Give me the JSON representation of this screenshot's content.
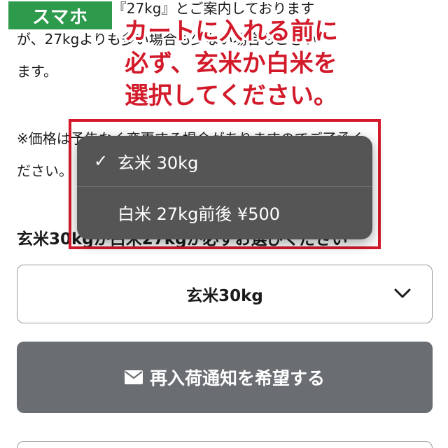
{
  "badge": {
    "label": "スマホ"
  },
  "description": {
    "line1": "※ご案内画像は『27kg』とご案内しております",
    "line2": "が、27kgよりも多い場合も少ない場合もござい",
    "line3": "ます。",
    "line4": "※価格は予告なく変更する場合がありますのでご了承く",
    "line5": "ださい。"
  },
  "callout": {
    "line1": "カートに入れる前に",
    "line2": "必ず、玄米か白米を",
    "line3": "選択してください。"
  },
  "dropdown": {
    "options": [
      {
        "check": "✓",
        "label": "玄米 30kg",
        "selected": true
      },
      {
        "check": "",
        "label": "白米 27kg前後 ¥500",
        "selected": false
      }
    ]
  },
  "select": {
    "label": "玄米30kgか白米27kgか必ずお選びください",
    "value": "玄米30kg",
    "chevron_icon": "chevron-down-icon"
  },
  "notify_button": {
    "icon": "envelope-icon",
    "label": "再入荷通知を希望する"
  },
  "colors": {
    "badge": "#2e9a4c",
    "callout": "#d21a2a",
    "popup": "#555555",
    "button": "#6a6e73"
  }
}
